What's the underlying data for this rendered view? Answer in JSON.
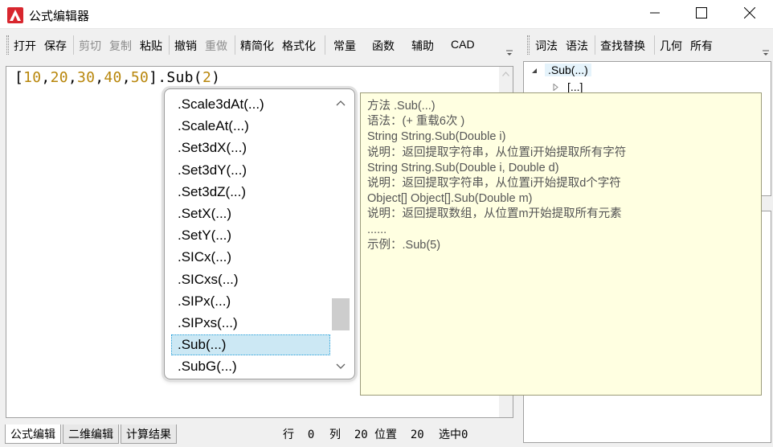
{
  "window": {
    "title": "公式编辑器",
    "logo_icon": "app-logo-icon",
    "accent_color": "#d8262e"
  },
  "toolbar_left": {
    "open": "打开",
    "save": "保存",
    "cut": "剪切",
    "copy": "复制",
    "paste": "粘贴",
    "undo": "撤销",
    "redo": "重做",
    "simplify": "精简化",
    "format": "格式化",
    "constants": "常量",
    "functions": "函数",
    "helpers": "辅助",
    "cad": "CAD"
  },
  "toolbar_right": {
    "lexical": "词法",
    "syntax": "语法",
    "find_replace": "查找替换",
    "geometry": "几何",
    "all": "所有"
  },
  "editor": {
    "tokens": [
      {
        "text": "[",
        "kind": "brk"
      },
      {
        "text": "10",
        "kind": "num"
      },
      {
        "text": ",",
        "kind": "com"
      },
      {
        "text": "20",
        "kind": "num"
      },
      {
        "text": ",",
        "kind": "com"
      },
      {
        "text": "30",
        "kind": "num"
      },
      {
        "text": ",",
        "kind": "com"
      },
      {
        "text": "40",
        "kind": "num"
      },
      {
        "text": ",",
        "kind": "com"
      },
      {
        "text": "50",
        "kind": "num"
      },
      {
        "text": "]",
        "kind": "brk"
      },
      {
        "text": ".Sub(",
        "kind": "mth"
      },
      {
        "text": "2",
        "kind": "num"
      },
      {
        "text": ")",
        "kind": "mth"
      }
    ],
    "number_color": "#b8860b"
  },
  "tree": {
    "root": ".Sub(...)",
    "child": "[...]"
  },
  "completion": {
    "items": [
      ".Scale3dAt(...)",
      ".ScaleAt(...)",
      ".Set3dX(...)",
      ".Set3dY(...)",
      ".Set3dZ(...)",
      ".SetX(...)",
      ".SetY(...)",
      ".SICx(...)",
      ".SICxs(...)",
      ".SIPx(...)",
      ".SIPxs(...)",
      ".Sub(...)",
      ".SubG(...)"
    ],
    "selected_index": 11,
    "selected_color": "#cce8f4"
  },
  "tooltip": {
    "lines": [
      "方法 .Sub(...)",
      "语法：(+ 重载6次 )",
      "String String.Sub(Double i)",
      "说明：返回提取字符串，从位置i开始提取所有字符",
      "String String.Sub(Double i, Double d)",
      "说明：返回提取字符串，从位置i开始提取d个字符",
      "Object[] Object[].Sub(Double m)",
      "说明：返回提取数组，从位置m开始提取所有元素",
      "......",
      "示例：.Sub(5)"
    ],
    "background": "#ffffe1"
  },
  "bottom_tabs": [
    "公式编辑",
    "二维编辑",
    "计算结果"
  ],
  "status": {
    "row_label": "行",
    "row_value": "0",
    "col_label": "列",
    "col_value": "20",
    "pos_label": "位置",
    "pos_value": "20",
    "sel_label": "选中",
    "sel_value": "0"
  }
}
